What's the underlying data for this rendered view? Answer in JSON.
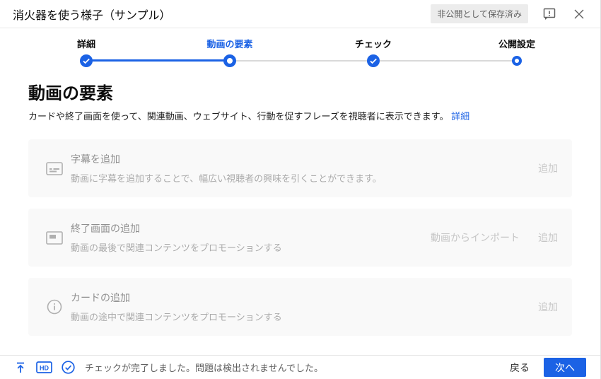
{
  "accent_color": "#1b62e5",
  "header": {
    "title": "消火器を使う様子（サンプル）",
    "badge": "非公開として保存済み",
    "icons": {
      "feedback": "feedback-icon",
      "close": "close-icon"
    }
  },
  "stepper": {
    "steps": [
      {
        "label": "詳細",
        "state": "done"
      },
      {
        "label": "動画の要素",
        "state": "current"
      },
      {
        "label": "チェック",
        "state": "done"
      },
      {
        "label": "公開設定",
        "state": "upcoming"
      }
    ]
  },
  "main": {
    "heading": "動画の要素",
    "description": "カードや終了画面を使って、関連動画、ウェブサイト、行動を促すフレーズを視聴者に表示できます。",
    "details_link": "詳細",
    "options": [
      {
        "icon": "subtitles-icon",
        "title": "字幕を追加",
        "description": "動画に字幕を追加することで、幅広い視聴者の興味を引くことができます。",
        "actions": [
          "追加"
        ]
      },
      {
        "icon": "end-screen-icon",
        "title": "終了画面の追加",
        "description": "動画の最後で関連コンテンツをプロモーションする",
        "actions": [
          "動画からインポート",
          "追加"
        ]
      },
      {
        "icon": "info-icon",
        "title": "カードの追加",
        "description": "動画の途中で関連コンテンツをプロモーションする",
        "actions": [
          "追加"
        ]
      }
    ]
  },
  "footer": {
    "icons": {
      "upload": "upload-icon",
      "hd": "hd-icon",
      "check": "check-circle-icon"
    },
    "hd_label": "HD",
    "status": "チェックが完了しました。問題は検出されませんでした。",
    "back_label": "戻る",
    "next_label": "次へ"
  }
}
